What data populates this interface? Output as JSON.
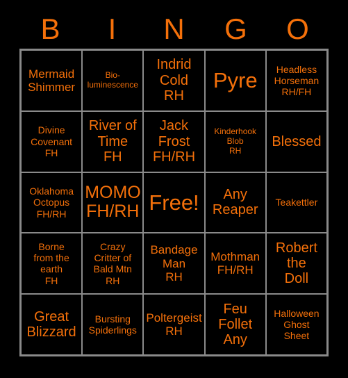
{
  "card": {
    "title": "BINGO",
    "accent_color": "#f4700a",
    "background_color": "#000000",
    "grid_line_color": "#8a8a8a",
    "columns": 5,
    "rows": 5
  },
  "header": {
    "letters": [
      "B",
      "I",
      "N",
      "G",
      "O"
    ]
  },
  "cells": [
    {
      "text": "Mermaid\nShimmer",
      "size": "md",
      "free": false
    },
    {
      "text": "Bio-\nluminescence",
      "size": "xs",
      "free": false
    },
    {
      "text": "Indrid\nCold\nRH",
      "size": "lg",
      "free": false
    },
    {
      "text": "Pyre",
      "size": "xxl",
      "free": false
    },
    {
      "text": "Headless\nHorseman\nRH/FH",
      "size": "sm",
      "free": false
    },
    {
      "text": "Divine\nCovenant\nFH",
      "size": "sm",
      "free": false
    },
    {
      "text": "River of\nTime\nFH",
      "size": "lg",
      "free": false
    },
    {
      "text": "Jack\nFrost\nFH/RH",
      "size": "lg",
      "free": false
    },
    {
      "text": "Kinderhook\nBlob\nRH",
      "size": "xs",
      "free": false
    },
    {
      "text": "Blessed",
      "size": "lg",
      "free": false
    },
    {
      "text": "Oklahoma\nOctopus\nFH/RH",
      "size": "sm",
      "free": false
    },
    {
      "text": "MOMO\nFH/RH",
      "size": "xl",
      "free": false
    },
    {
      "text": "Free!",
      "size": "xxl",
      "free": true
    },
    {
      "text": "Any\nReaper",
      "size": "lg",
      "free": false
    },
    {
      "text": "Teakettler",
      "size": "sm",
      "free": false
    },
    {
      "text": "Borne\nfrom the\nearth\nFH",
      "size": "sm",
      "free": false
    },
    {
      "text": "Crazy\nCritter of\nBald Mtn\nRH",
      "size": "sm",
      "free": false
    },
    {
      "text": "Bandage\nMan\nRH",
      "size": "md",
      "free": false
    },
    {
      "text": "Mothman\nFH/RH",
      "size": "md",
      "free": false
    },
    {
      "text": "Robert\nthe\nDoll",
      "size": "lg",
      "free": false
    },
    {
      "text": "Great\nBlizzard",
      "size": "lg",
      "free": false
    },
    {
      "text": "Bursting\nSpiderlings",
      "size": "sm",
      "free": false
    },
    {
      "text": "Poltergeist\nRH",
      "size": "md",
      "free": false
    },
    {
      "text": "Feu\nFollet\nAny",
      "size": "lg",
      "free": false
    },
    {
      "text": "Halloween\nGhost\nSheet",
      "size": "sm",
      "free": false
    }
  ]
}
